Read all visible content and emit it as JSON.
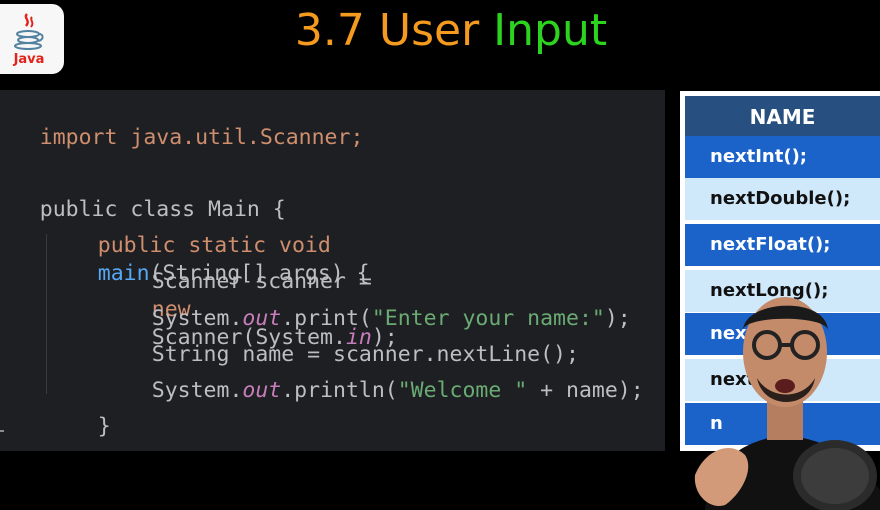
{
  "logo": {
    "label": "Java",
    "brand_color": "#e2231a"
  },
  "title": {
    "number": "3.7 User",
    "highlight": "Input",
    "number_color": "#f39a1f",
    "highlight_color": "#2cd31f"
  },
  "code": {
    "lines": [
      [
        "import java.util.Scanner;"
      ],
      [],
      [
        "public class Main {"
      ],
      [
        "public static void",
        "main",
        "(String[] args) {"
      ],
      [
        "Scanner scanner =",
        "new",
        "Scanner(System.",
        "in",
        ");"
      ],
      [
        "System.",
        "out",
        ".print(",
        "\"Enter your name:\"",
        ");"
      ],
      [
        "String name = scanner.nextLine();"
      ],
      [
        "System.",
        "out",
        ".println(",
        "\"Welcome \"",
        " + name);"
      ],
      [
        "}"
      ]
    ]
  },
  "methods_table": {
    "header": "NAME",
    "rows": [
      "nextInt();",
      "nextDouble();",
      "nextFloat();",
      "nextLong();",
      "next",
      "next",
      "n"
    ]
  },
  "colors": {
    "code_bg": "#1e1f22",
    "keyword": "#cf8e6d",
    "function": "#56a8f5",
    "string": "#6aab73",
    "field": "#c77dbb"
  }
}
